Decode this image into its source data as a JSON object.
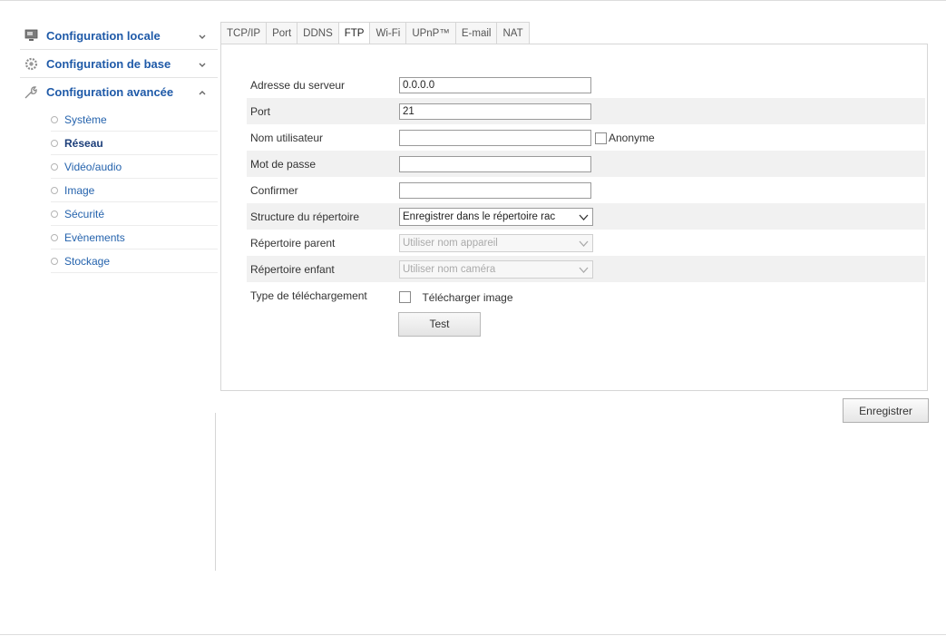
{
  "sidebar": {
    "sections": [
      {
        "title": "Configuration locale",
        "icon": "monitor-icon",
        "state": "collapsed"
      },
      {
        "title": "Configuration de base",
        "icon": "gear-icon",
        "state": "collapsed"
      },
      {
        "title": "Configuration avancée",
        "icon": "wrench-icon",
        "state": "expanded"
      }
    ],
    "advanced_items": [
      {
        "label": "Système"
      },
      {
        "label": "Réseau",
        "active": true
      },
      {
        "label": "Vidéo/audio"
      },
      {
        "label": "Image"
      },
      {
        "label": "Sécurité"
      },
      {
        "label": "Evènements"
      },
      {
        "label": "Stockage"
      }
    ]
  },
  "tabs": [
    {
      "label": "TCP/IP"
    },
    {
      "label": "Port"
    },
    {
      "label": "DDNS"
    },
    {
      "label": "FTP",
      "active": true
    },
    {
      "label": "Wi-Fi"
    },
    {
      "label": "UPnP™"
    },
    {
      "label": "E-mail"
    },
    {
      "label": "NAT"
    }
  ],
  "ftp": {
    "server_address_label": "Adresse du serveur",
    "server_address_value": "0.0.0.0",
    "port_label": "Port",
    "port_value": "21",
    "username_label": "Nom utilisateur",
    "username_value": "",
    "anonymous_label": "Anonyme",
    "password_label": "Mot de passe",
    "password_value": "",
    "confirm_label": "Confirmer",
    "confirm_value": "",
    "dir_structure_label": "Structure du répertoire",
    "dir_structure_value": "Enregistrer dans le répertoire rac",
    "parent_dir_label": "Répertoire parent",
    "parent_dir_value": "Utiliser nom appareil",
    "child_dir_label": "Répertoire enfant",
    "child_dir_value": "Utiliser nom caméra",
    "upload_type_label": "Type de téléchargement",
    "upload_image_label": "Télécharger image",
    "test_button": "Test"
  },
  "save_button": "Enregistrer",
  "colors": {
    "link_blue": "#1f5aa8",
    "active_text": "#1d3f7a"
  }
}
